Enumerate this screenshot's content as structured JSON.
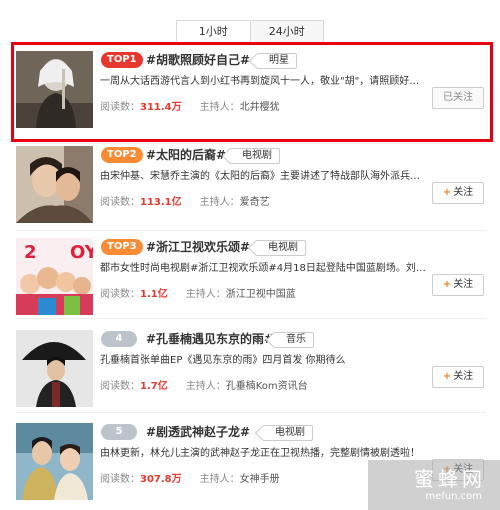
{
  "tabs": [
    "1小时",
    "24小时"
  ],
  "labels": {
    "reads": "阅读数：",
    "host": "主持人："
  },
  "follow": {
    "add_label": "关注",
    "done_label": "已关注"
  },
  "items": [
    {
      "rank": "TOP1",
      "topic": "#胡歌照顾好自己#",
      "category": "明星",
      "desc": "一周从大话西游代言人到小红书再到旋风十一人，敬业\"胡\"，请照顾好自...",
      "reads": "311.4万",
      "host": "北井樱犹",
      "followed": true
    },
    {
      "rank": "TOP2",
      "topic": "#太阳的后裔#",
      "category": "电视剧",
      "desc": "由宋仲基、宋慧乔主演的《太阳的后裔》主要讲述了特战部队海外派兵组...",
      "reads": "113.1亿",
      "host": "爱奇艺",
      "followed": false
    },
    {
      "rank": "TOP3",
      "topic": "#浙江卫视欢乐颂#",
      "category": "电视剧",
      "desc": "都市女性时尚电视剧#浙江卫视欢乐颂#4月18日起登陆中国蓝剧场。刘涛、...",
      "reads": "1.1亿",
      "host": "浙江卫视中国蓝",
      "followed": false
    },
    {
      "rank": "4",
      "topic": "#孔垂楠遇见东京的雨#",
      "category": "音乐",
      "desc": "孔垂楠首张单曲EP《遇见东京的雨》四月首发 你期待么",
      "reads": "1.7亿",
      "host": "孔垂楠Kom资讯台",
      "followed": false
    },
    {
      "rank": "5",
      "topic": "#剧透武神赵子龙#",
      "category": "电视剧",
      "desc": "由林更新，林允儿主演的武神赵子龙正在卫视热播，完整剧情被剧透啦！",
      "reads": "307.8万",
      "host": "女神手册",
      "followed": false
    }
  ],
  "watermark": {
    "cn": "蜜蜂网",
    "en": "mefun.com"
  }
}
